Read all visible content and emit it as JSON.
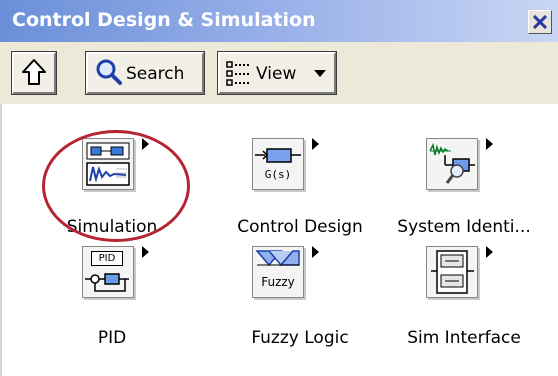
{
  "window": {
    "title": "Control Design & Simulation"
  },
  "toolbar": {
    "search_label": "Search",
    "view_label": "View"
  },
  "palette": {
    "items": [
      {
        "label": "Simulation",
        "icon": "simulation-icon"
      },
      {
        "label": "Control Design",
        "icon": "control-design-icon",
        "glyph": "G(s)"
      },
      {
        "label": "System Identi...",
        "icon": "system-identification-icon"
      },
      {
        "label": "PID",
        "icon": "pid-icon",
        "glyph": "PID"
      },
      {
        "label": "Fuzzy Logic",
        "icon": "fuzzy-logic-icon",
        "glyph": "Fuzzy"
      },
      {
        "label": "Sim Interface",
        "icon": "sim-interface-icon"
      }
    ]
  },
  "colors": {
    "title_bar": "#6b8fd8",
    "highlight": "#b52430"
  }
}
